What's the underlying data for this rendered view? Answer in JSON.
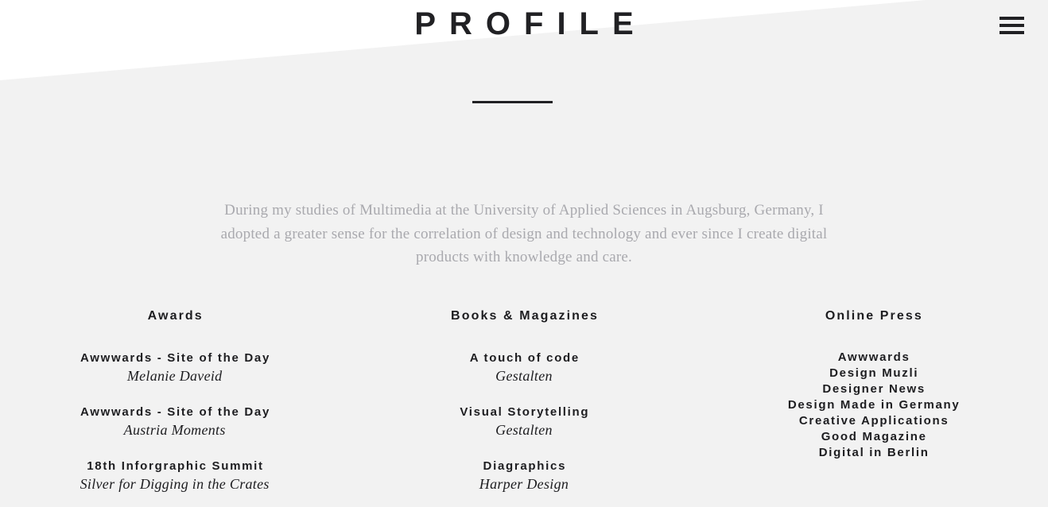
{
  "header": {
    "brand_title": "PROFILE",
    "menu_icon": "hamburger-menu-icon"
  },
  "colors": {
    "page_background": "#f2f2f2",
    "wedge_background": "#ffffff",
    "text_dark": "#1d1d20",
    "text_muted": "#a9a9ae",
    "accent_rule": "#212124"
  },
  "intro": {
    "paragraph": "During my studies of Multimedia at the University of Applied Sciences in Augsburg, Germany, I adopted a greater sense for the correlation of design and technology and ever since I create digital products with knowledge and care."
  },
  "columns": [
    {
      "heading": "Awards",
      "entries": [
        {
          "title": "Awwwards - Site of the Day",
          "subtitle": "Melanie Daveid"
        },
        {
          "title": "Awwwards - Site of the Day",
          "subtitle": "Austria Moments"
        },
        {
          "title": "18th Inforgraphic Summit",
          "subtitle": "Silver for Digging in the Crates"
        }
      ]
    },
    {
      "heading": "Books & Magazines",
      "entries": [
        {
          "title": "A touch of code",
          "subtitle": "Gestalten"
        },
        {
          "title": "Visual Storytelling",
          "subtitle": "Gestalten"
        },
        {
          "title": "Diagraphics",
          "subtitle": "Harper Design"
        }
      ]
    },
    {
      "heading": "Online Press",
      "items": [
        "Awwwards",
        "Design Muzli",
        "Designer News",
        "Design Made in Germany",
        "Creative Applications",
        "Good Magazine",
        "Digital in Berlin"
      ]
    }
  ]
}
